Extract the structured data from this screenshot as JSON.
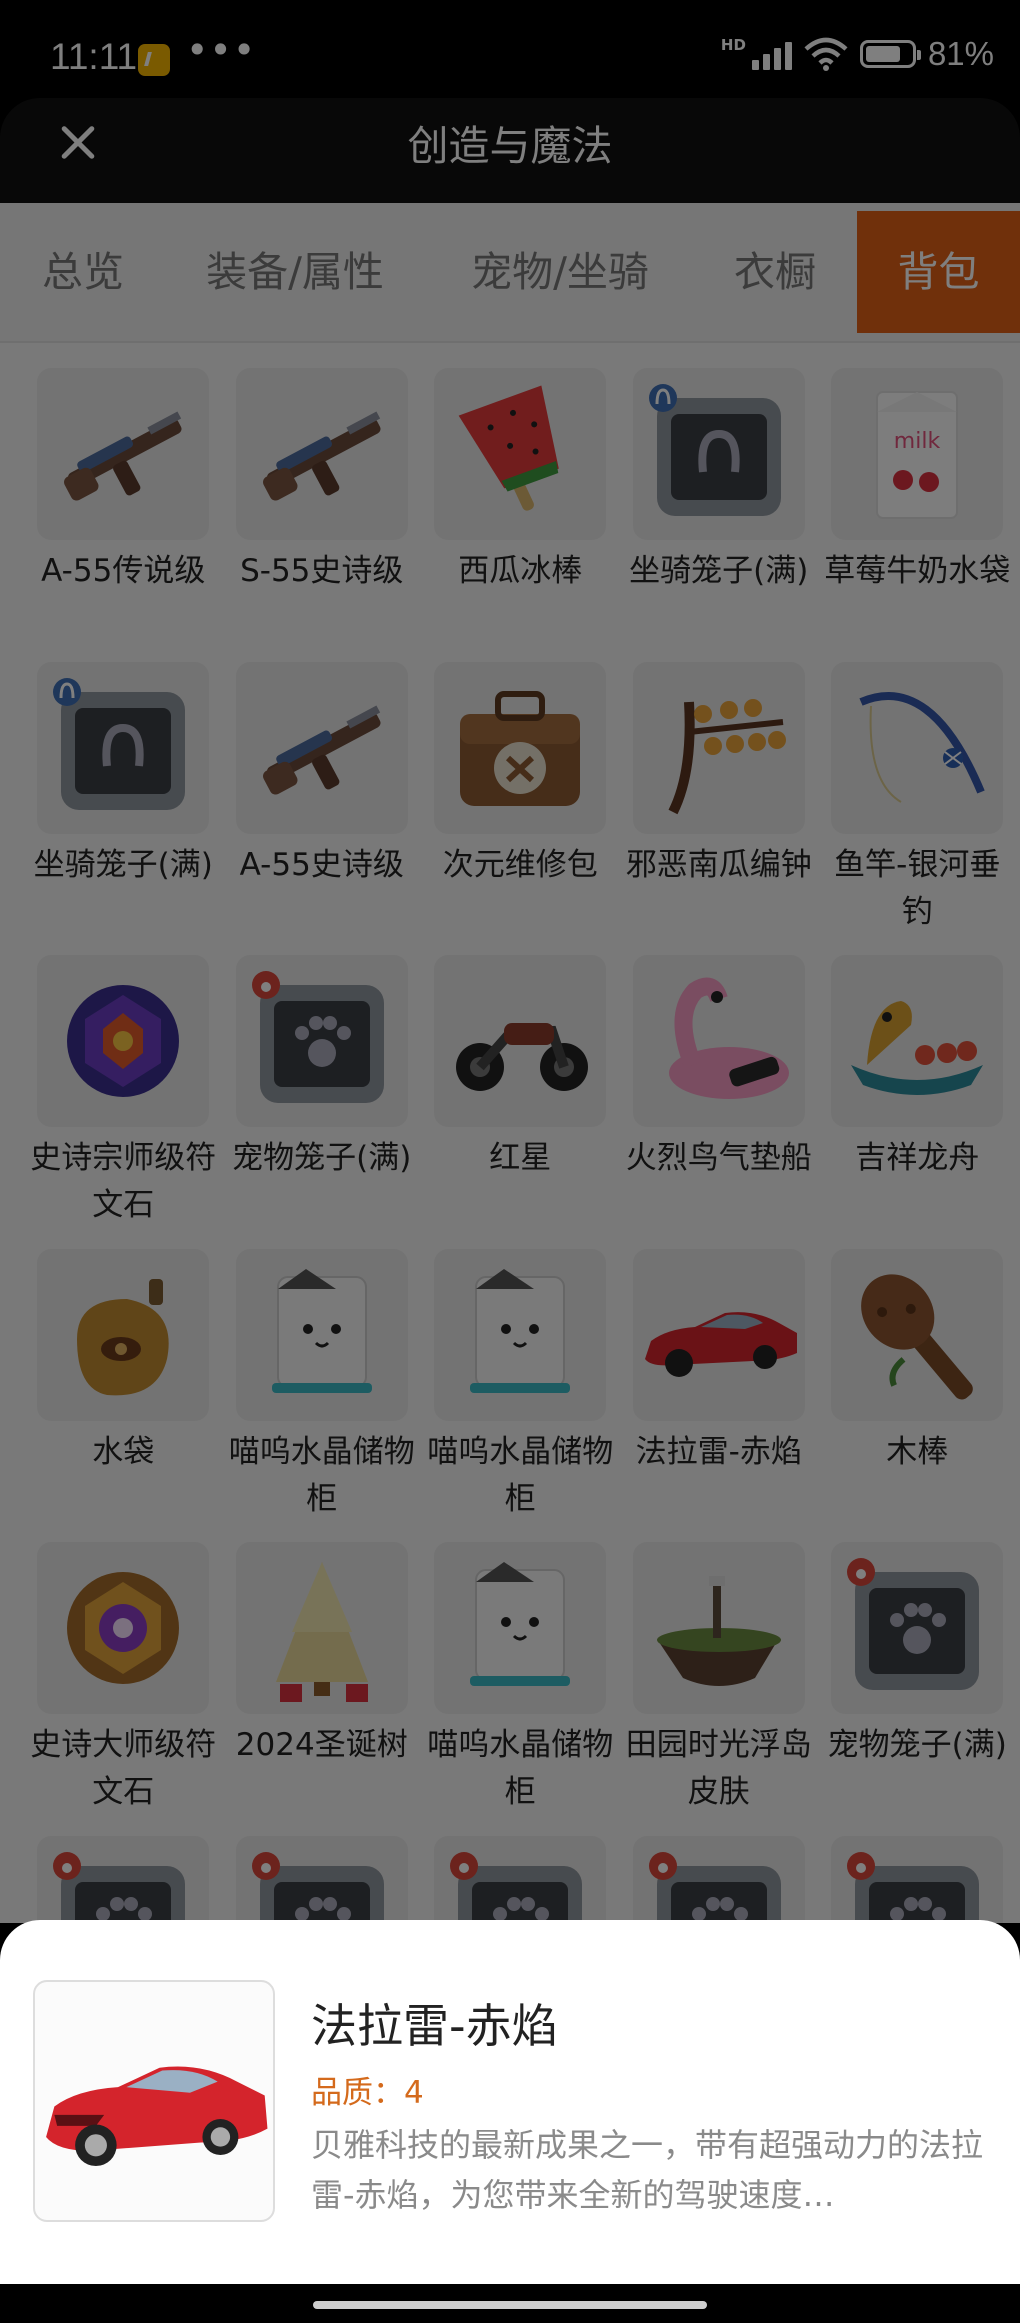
{
  "status_bar": {
    "time": "11:11",
    "dots": "•••",
    "hd": "HD",
    "battery": "81%"
  },
  "header": {
    "title": "创造与魔法"
  },
  "tabs": [
    {
      "label": "总览"
    },
    {
      "label": "装备/属性"
    },
    {
      "label": "宠物/坐骑"
    },
    {
      "label": "衣橱"
    },
    {
      "label": "背包",
      "active": true
    }
  ],
  "items": [
    {
      "name": "A-55传说级",
      "icon": "gun-icon"
    },
    {
      "name": "S-55史诗级",
      "icon": "gun-icon"
    },
    {
      "name": "西瓜冰棒",
      "icon": "watermelon-popsicle-icon"
    },
    {
      "name": "坐骑笼子(满)",
      "icon": "mount-cage-icon"
    },
    {
      "name": "草莓牛奶水袋",
      "icon": "milk-bag-icon"
    },
    {
      "name": "坐骑笼子(满)",
      "icon": "mount-cage-icon"
    },
    {
      "name": "A-55史诗级",
      "icon": "gun-icon"
    },
    {
      "name": "次元维修包",
      "icon": "repair-bag-icon"
    },
    {
      "name": "邪恶南瓜编钟",
      "icon": "pumpkin-chime-icon"
    },
    {
      "name": "鱼竿-银河垂钓",
      "icon": "fishing-rod-icon"
    },
    {
      "name": "史诗宗师级符文石",
      "icon": "rune-stone-icon"
    },
    {
      "name": "宠物笼子(满)",
      "icon": "pet-cage-icon"
    },
    {
      "name": "红星",
      "icon": "motorcycle-icon"
    },
    {
      "name": "火烈鸟气垫船",
      "icon": "flamingo-float-icon"
    },
    {
      "name": "吉祥龙舟",
      "icon": "dragon-boat-icon"
    },
    {
      "name": "水袋",
      "icon": "water-bag-icon"
    },
    {
      "name": "喵呜水晶储物柜",
      "icon": "cat-cabinet-icon"
    },
    {
      "name": "喵呜水晶储物柜",
      "icon": "cat-cabinet-icon"
    },
    {
      "name": "法拉雷-赤焰",
      "icon": "red-car-icon"
    },
    {
      "name": "木棒",
      "icon": "wooden-club-icon"
    },
    {
      "name": "史诗大师级符文石",
      "icon": "rune-stone-gold-icon"
    },
    {
      "name": "2024圣诞树",
      "icon": "christmas-tree-icon"
    },
    {
      "name": "喵呜水晶储物柜",
      "icon": "cat-cabinet-icon"
    },
    {
      "name": "田园时光浮岛皮肤",
      "icon": "floating-island-icon"
    },
    {
      "name": "宠物笼子(满)",
      "icon": "pet-cage-icon"
    },
    {
      "name": "",
      "icon": "pet-cage-icon"
    },
    {
      "name": "",
      "icon": "pet-cage-icon"
    },
    {
      "name": "",
      "icon": "pet-cage-icon"
    },
    {
      "name": "",
      "icon": "pet-cage-icon"
    },
    {
      "name": "",
      "icon": "pet-cage-icon"
    }
  ],
  "detail": {
    "name": "法拉雷-赤焰",
    "quality": "品质：4",
    "description": "贝雅科技的最新成果之一，带有超强动力的法拉雷-赤焰，为您带来全新的驾驶速度…",
    "icon": "red-car-icon"
  },
  "colors": {
    "accent": "#e06016",
    "quality": "#d46a1c"
  }
}
